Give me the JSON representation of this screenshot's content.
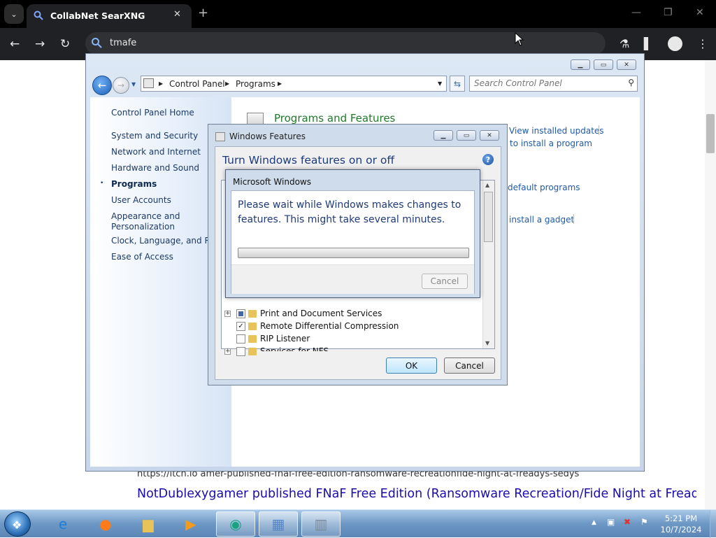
{
  "browser": {
    "tab_title": "CollabNet SearXNG",
    "tab_close": "✕",
    "new_tab": "+",
    "address_value": "tmafe",
    "tab_dropdown": "⌄"
  },
  "page": {
    "result_url": "https://itch.io  amer-published-fnaf-free-edition-ransomware-recreationfide-night-at-freadys-sedys",
    "result_title": "NotDublexygamer published FNaF Free Edition (Ransomware Recreation/Fide Night at Fready's Sedys) - itch.io"
  },
  "control_panel": {
    "breadcrumb": [
      "Control Panel",
      "Programs"
    ],
    "search_placeholder": "Search Control Panel",
    "nav": {
      "home": "Control Panel Home",
      "items": [
        "System and Security",
        "Network and Internet",
        "Hardware and Sound",
        "Programs",
        "User Accounts",
        "Appearance and\nPersonalization",
        "Clock, Language, and Reg",
        "Ease of Access"
      ],
      "active": "Programs",
      "bullet": "•"
    },
    "section_title": "Programs and Features",
    "links": [
      "View installed updates",
      "to install a program",
      "default programs",
      "install a gadget"
    ]
  },
  "windows_features": {
    "title": "Windows Features",
    "heading": "Turn Windows features on or off",
    "help": "?",
    "items": [
      {
        "label": "Print and Document Services",
        "state": "partial",
        "expandable": true
      },
      {
        "label": "Remote Differential Compression",
        "state": "checked",
        "expandable": false
      },
      {
        "label": "RIP Listener",
        "state": "unchecked",
        "expandable": false
      },
      {
        "label": "Services for NFS",
        "state": "unchecked",
        "expandable": true
      }
    ],
    "ok": "OK",
    "cancel": "Cancel"
  },
  "progress_dialog": {
    "title": "Microsoft Windows",
    "message": "Please wait while Windows makes changes to features. This might take several minutes.",
    "progress": 0,
    "cancel": "Cancel"
  },
  "taskbar": {
    "time": "5:21 PM",
    "date": "10/7/2024"
  },
  "colors": {
    "chrome_bg": "#202124",
    "link_blue": "#1a0dab",
    "cp_green": "#1f7a29"
  }
}
